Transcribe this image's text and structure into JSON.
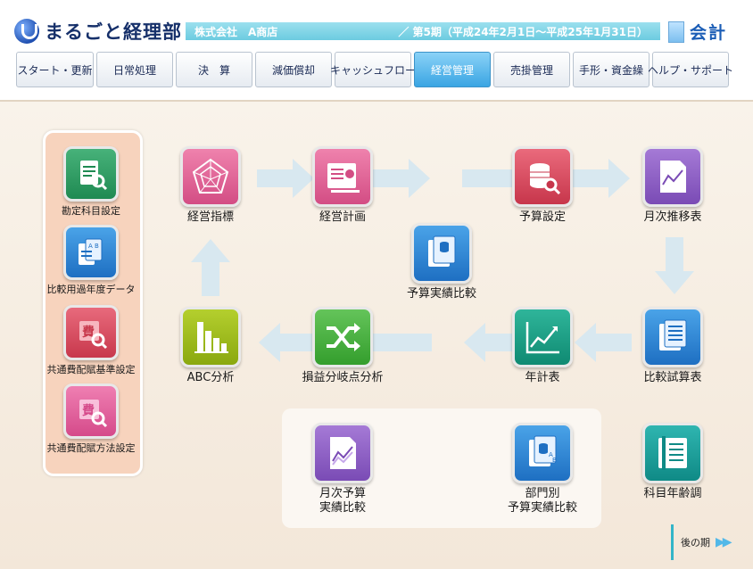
{
  "header": {
    "app_name": "まるごと経理部",
    "company": "株式会社　A商店",
    "period": "／ 第5期（平成24年2月1日～平成25年1月31日）",
    "module": "会計"
  },
  "menu": [
    {
      "label": "スタート・更新",
      "width": 87
    },
    {
      "label": "日常処理",
      "width": 86
    },
    {
      "label": "決　算",
      "width": 86
    },
    {
      "label": "減価償却",
      "width": 86
    },
    {
      "label": "キャッシュフロー",
      "width": 86
    },
    {
      "label": "経営管理",
      "width": 86,
      "active": true
    },
    {
      "label": "売掛管理",
      "width": 86
    },
    {
      "label": "手形・資金繰",
      "width": 86
    },
    {
      "label": "ヘルプ・サポート",
      "width": 86
    }
  ],
  "side_items": {
    "account_setup": "勘定科目設定",
    "comparison_data": "比較用過年度データ",
    "common_cost_basis": "共通費配賦基準設定",
    "common_cost_method": "共通費配賦方法設定"
  },
  "flow": {
    "management_indicators": "経営指標",
    "management_plan": "経営計画",
    "budget_setup": "予算設定",
    "monthly_trend": "月次推移表",
    "budget_actual_compare": "予算実績比較",
    "comparison_trial": "比較試算表",
    "annual_table": "年計表",
    "breakeven": "損益分岐点分析",
    "abc": "ABC分析",
    "monthly_budget_line1": "月次予算",
    "monthly_budget_line2": "実績比較",
    "dept_line1": "部門別",
    "dept_line2": "予算実績比較",
    "account_aging": "科目年齢調"
  },
  "footer": {
    "next_period": "後の期"
  },
  "colors": {
    "accent_active": "#3aa5e3",
    "infobar": "#6ccbe0",
    "side_panel": "#f7d3bd"
  }
}
